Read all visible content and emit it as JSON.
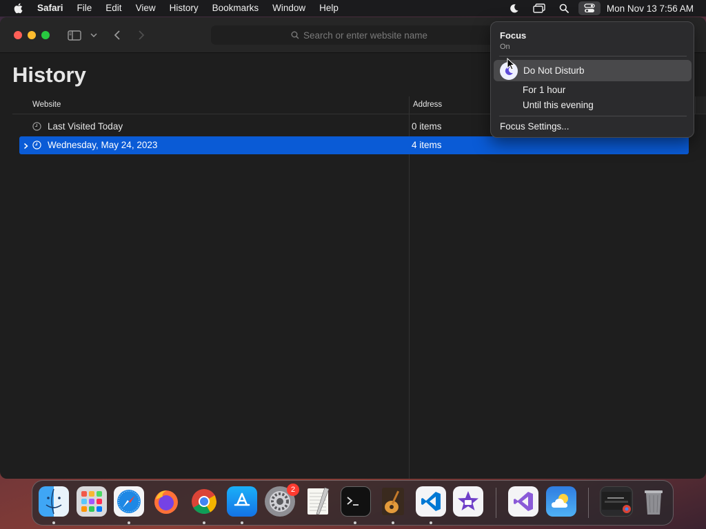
{
  "menubar": {
    "app_name": "Safari",
    "items": [
      "File",
      "Edit",
      "View",
      "History",
      "Bookmarks",
      "Window",
      "Help"
    ],
    "clock": "Mon Nov 13  7:56 AM"
  },
  "toolbar": {
    "search_placeholder": "Search or enter website name"
  },
  "page": {
    "title": "History",
    "columns": {
      "website": "Website",
      "address": "Address"
    },
    "rows": [
      {
        "title": "Last Visited Today",
        "address": "0 items",
        "selected": false
      },
      {
        "title": "Wednesday, May 24, 2023",
        "address": "4 items",
        "selected": true
      }
    ]
  },
  "focus_popover": {
    "title": "Focus",
    "status": "On",
    "mode": "Do Not Disturb",
    "options": [
      "For 1 hour",
      "Until this evening"
    ],
    "settings_label": "Focus Settings..."
  },
  "dock": {
    "apps": [
      "Finder",
      "Launchpad",
      "Safari",
      "Firefox",
      "Chrome",
      "App Store",
      "System Settings",
      "TextEdit",
      "Terminal",
      "GarageBand",
      "Visual Studio Code",
      "iMovie",
      "Visual Studio",
      "Weather",
      "Chrome Window",
      "Trash"
    ],
    "settings_badge": "2"
  },
  "colors": {
    "selection": "#0a5bd6",
    "accent_dnd": "#5e4bd8"
  }
}
